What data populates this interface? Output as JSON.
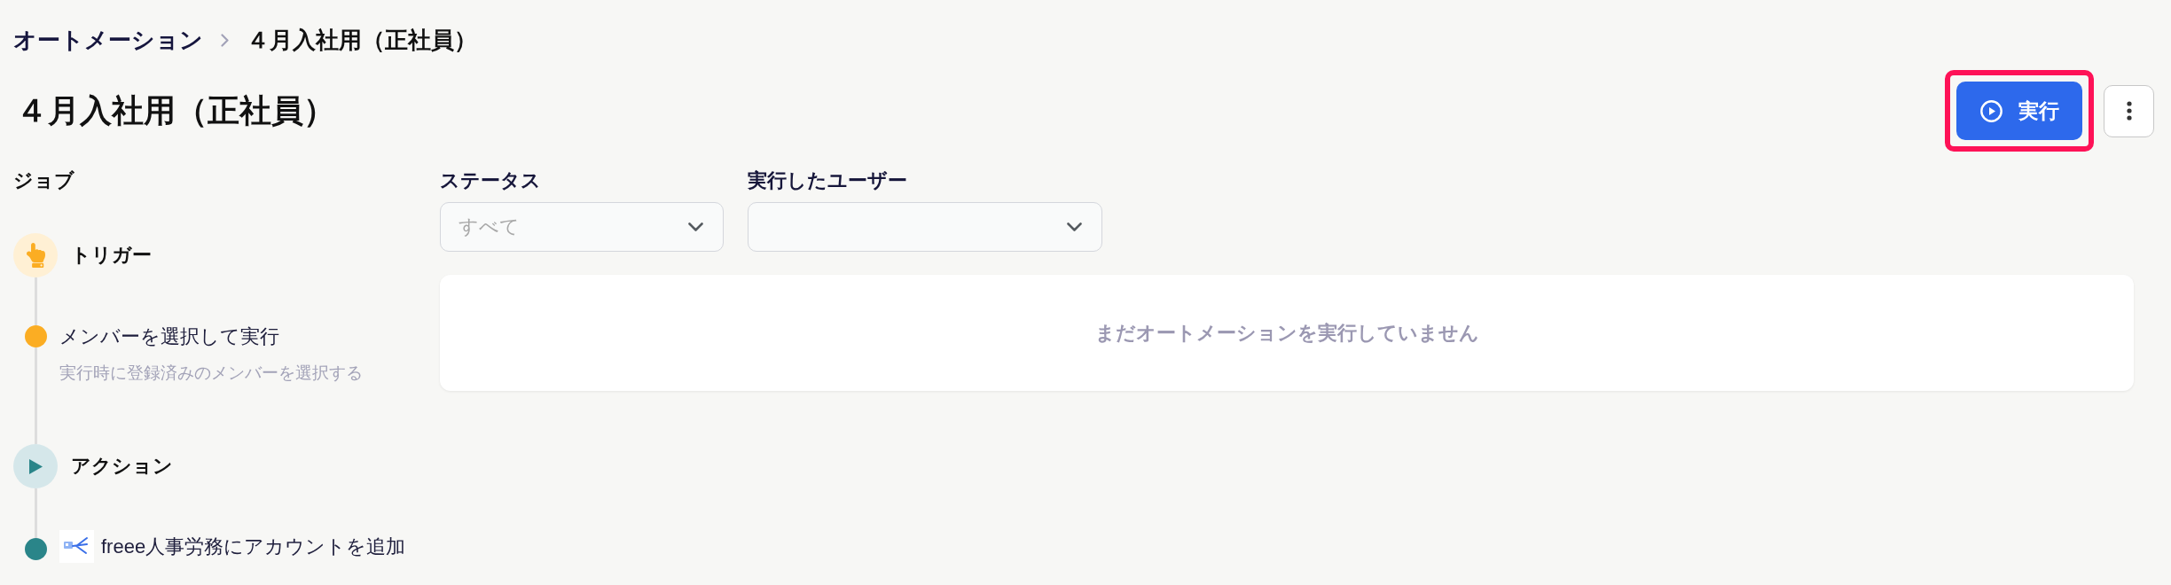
{
  "breadcrumb": [
    {
      "label": "オートメーション",
      "kind": "link"
    },
    {
      "label": "４月入社用（正社員）",
      "kind": "current"
    }
  ],
  "page_title": "４月入社用（正社員）",
  "run_button": {
    "label": "実行",
    "highlighted": true
  },
  "sidebar": {
    "title": "ジョブ",
    "steps": [
      {
        "kind": "trigger",
        "label": "トリガー",
        "color": "#fbad23",
        "children": [
          {
            "label": "メンバーを選択して実行",
            "description": "実行時に登録済みのメンバーを選択する"
          }
        ]
      },
      {
        "kind": "action",
        "label": "アクション",
        "color": "#2a8589",
        "children": [
          {
            "label": "freee人事労務にアカウントを追加",
            "has_logo": true
          }
        ]
      }
    ]
  },
  "filters": [
    {
      "label": "ステータス",
      "placeholder": "すべて"
    },
    {
      "label": "実行したユーザー"
    }
  ],
  "empty_state": {
    "message": "まだオートメーションを実行していません"
  }
}
